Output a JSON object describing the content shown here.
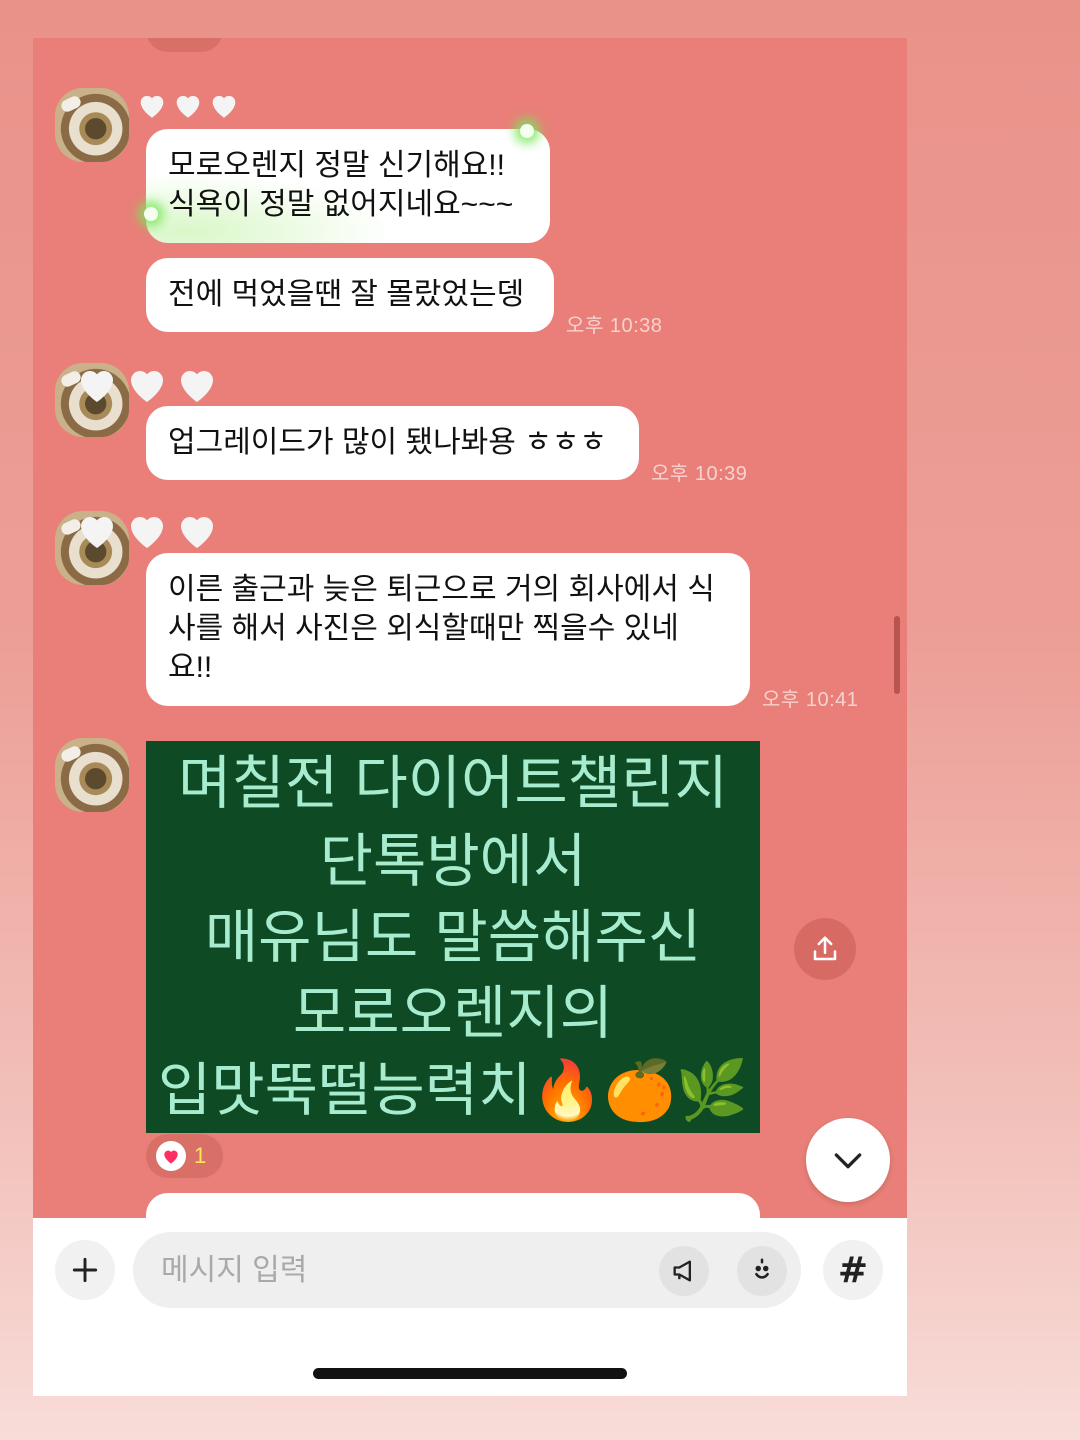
{
  "chat": {
    "messages": [
      {
        "lines": [
          "모로오렌지 정말 신기해요!!",
          "식욕이 정말 없어지네요~~~"
        ]
      },
      {
        "lines": [
          "전에 먹었을땐 잘 몰랐었는뎅"
        ],
        "time": "오후 10:38"
      },
      {
        "lines": [
          "업그레이드가 많이 됐나봐용 ㅎㅎㅎ"
        ],
        "time": "오후 10:39"
      },
      {
        "lines": [
          "이른 출근과 늦은 퇴근으로 거의 회사에서 식",
          "사를 해서 사진은 외식할때만 찍을수 있네",
          "요!!"
        ],
        "time": "오후 10:41"
      }
    ],
    "image_card": {
      "lines": [
        "며칠전 다이어트챌린지",
        "단톡방에서",
        "매유님도 말씀해주신",
        "모로오렌지의",
        "입맛뚝떨능력치🔥🍊🌿"
      ]
    },
    "reaction": {
      "count": "1",
      "emoji_icon": "heart-icon",
      "color": "#ff2e63"
    }
  },
  "input_bar": {
    "placeholder": "메시지 입력",
    "hash_label": "#"
  },
  "colors": {
    "chat_background": "#e97f78",
    "card_background": "#0e4a23",
    "card_text": "#a8ecd0"
  }
}
